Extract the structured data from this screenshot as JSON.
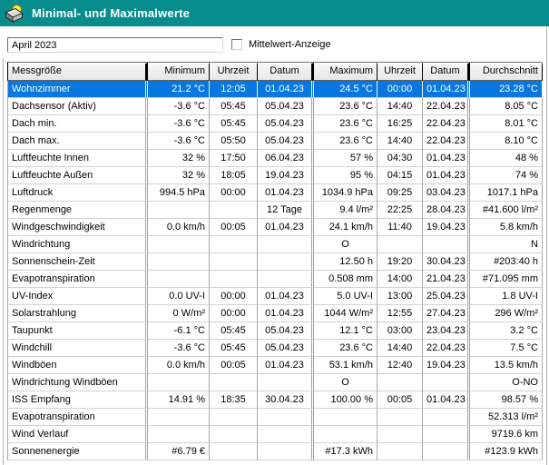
{
  "window": {
    "title": "Minimal- und Maximalwerte",
    "icon": "weather-station-icon"
  },
  "colors": {
    "titlebar": "#068C8C",
    "selection": "#0878E0",
    "header_bg": "#EFEFEF",
    "sun_yellow": "#FFE92A"
  },
  "controls": {
    "period_value": "April 2023",
    "mittelwert_label": "Mittelwert-Anzeige",
    "mittelwert_checked": false
  },
  "table": {
    "columns": [
      {
        "label": "Messgröße",
        "align": "left",
        "group_separator": true
      },
      {
        "label": "Minimum",
        "align": "right",
        "group_separator": false
      },
      {
        "label": "Uhrzeit",
        "align": "center",
        "group_separator": false
      },
      {
        "label": "Datum",
        "align": "center",
        "group_separator": true
      },
      {
        "label": "Maximum",
        "align": "right",
        "group_separator": false
      },
      {
        "label": "Uhrzeit",
        "align": "center",
        "group_separator": false
      },
      {
        "label": "Datum",
        "align": "center",
        "group_separator": true
      },
      {
        "label": "Durchschnitt",
        "align": "right",
        "group_separator": false
      }
    ],
    "selected_row_index": 0,
    "rows": [
      {
        "cells": [
          "Wohnzimmer",
          "21.2 °C",
          "12:05",
          "01.04.23",
          "24.5 °C",
          "00:00",
          "01.04.23",
          "23.28 °C"
        ],
        "selected": true
      },
      {
        "cells": [
          "Dachsensor (Aktiv)",
          "-3.6 °C",
          "05:45",
          "05.04.23",
          "23.6 °C",
          "14:40",
          "22.04.23",
          "8.05 °C"
        ],
        "selected": false
      },
      {
        "cells": [
          "Dach min.",
          "-3.6 °C",
          "05:45",
          "05.04.23",
          "23.6 °C",
          "16:25",
          "22.04.23",
          "8.01 °C"
        ],
        "selected": false
      },
      {
        "cells": [
          "Dach max.",
          "-3.6 °C",
          "05:50",
          "05.04.23",
          "23.6 °C",
          "14:40",
          "22.04.23",
          "8.10 °C"
        ],
        "selected": false
      },
      {
        "cells": [
          "Luftfeuchte Innen",
          "32 %",
          "17:50",
          "06.04.23",
          "57 %",
          "04:30",
          "01.04.23",
          "48 %"
        ],
        "selected": false
      },
      {
        "cells": [
          "Luftfeuchte Außen",
          "32 %",
          "18:05",
          "19.04.23",
          "95 %",
          "04:15",
          "01.04.23",
          "74 %"
        ],
        "selected": false
      },
      {
        "cells": [
          "Luftdruck",
          "994.5 hPa",
          "00:00",
          "01.04.23",
          "1034.9 hPa",
          "09:25",
          "03.04.23",
          "1017.1 hPa"
        ],
        "selected": false
      },
      {
        "cells": [
          "Regenmenge",
          "",
          "",
          "12 Tage",
          "9.4 l/m²",
          "22:25",
          "28.04.23",
          "#41.600 l/m²"
        ],
        "selected": false
      },
      {
        "cells": [
          "Windgeschwindigkeit",
          "0.0 km/h",
          "00:05",
          "01.04.23",
          "24.1 km/h",
          "11:40",
          "19.04.23",
          "5.8 km/h"
        ],
        "selected": false
      },
      {
        "cells": [
          "Windrichtung",
          "",
          "",
          "",
          "O",
          "",
          "",
          "N"
        ],
        "selected": false
      },
      {
        "cells": [
          "Sonnenschein-Zeit",
          "",
          "",
          "",
          "12.50 h",
          "19:20",
          "30.04.23",
          "#203:40 h"
        ],
        "selected": false
      },
      {
        "cells": [
          "Evapotranspiration",
          "",
          "",
          "",
          "0.508 mm",
          "14:00",
          "21.04.23",
          "#71.095 mm"
        ],
        "selected": false
      },
      {
        "cells": [
          "UV-Index",
          "0.0 UV-I",
          "00:00",
          "01.04.23",
          "5.0 UV-I",
          "13:00",
          "25.04.23",
          "1.8 UV-I"
        ],
        "selected": false
      },
      {
        "cells": [
          "Solarstrahlung",
          "0 W/m²",
          "00:00",
          "01.04.23",
          "1044 W/m²",
          "12:55",
          "27.04.23",
          "296 W/m²"
        ],
        "selected": false
      },
      {
        "cells": [
          "Taupunkt",
          "-6.1 °C",
          "05:45",
          "05.04.23",
          "12.1 °C",
          "03:00",
          "23.04.23",
          "3.2 °C"
        ],
        "selected": false
      },
      {
        "cells": [
          "Windchill",
          "-3.6 °C",
          "05:45",
          "05.04.23",
          "23.6 °C",
          "14:40",
          "22.04.23",
          "7.5 °C"
        ],
        "selected": false
      },
      {
        "cells": [
          "Windböen",
          "0.0 km/h",
          "00:05",
          "01.04.23",
          "53.1 km/h",
          "12:40",
          "19.04.23",
          "13.5 km/h"
        ],
        "selected": false
      },
      {
        "cells": [
          "Windrichtung Windböen",
          "",
          "",
          "",
          "O",
          "",
          "",
          "O-NO"
        ],
        "selected": false
      },
      {
        "cells": [
          "ISS Empfang",
          "14.91 %",
          "18:35",
          "30.04.23",
          "100.00 %",
          "00:05",
          "01.04.23",
          "98.57 %"
        ],
        "selected": false
      },
      {
        "cells": [
          "Evapotranspiration",
          "",
          "",
          "",
          "",
          "",
          "",
          "52.313 l/m²"
        ],
        "selected": false
      },
      {
        "cells": [
          "Wind Verlauf",
          "",
          "",
          "",
          "",
          "",
          "",
          "9719.6 km"
        ],
        "selected": false
      },
      {
        "cells": [
          "Sonnenenergie",
          "#6.79 €",
          "",
          "",
          "#17.3 kWh",
          "",
          "",
          "#123.9 kWh"
        ],
        "selected": false
      }
    ]
  }
}
